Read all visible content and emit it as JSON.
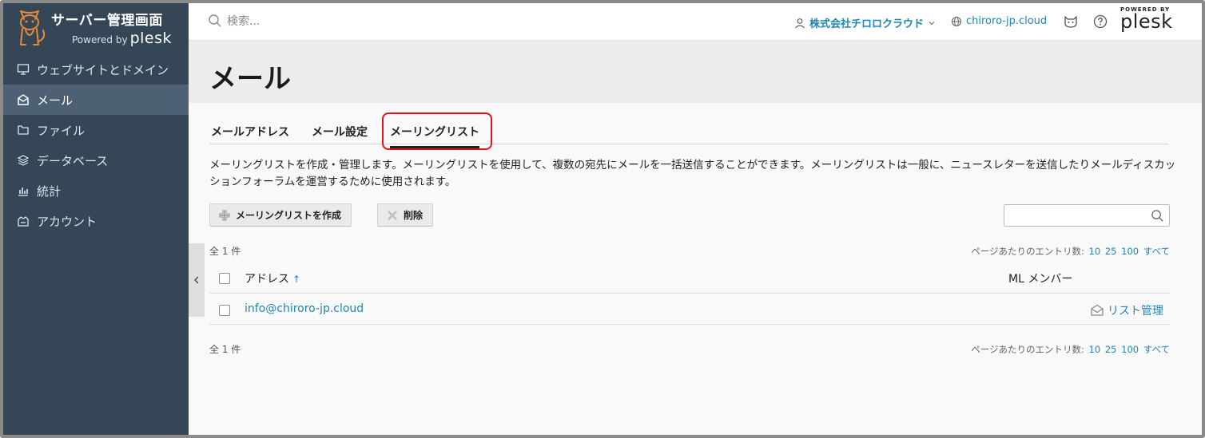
{
  "sidebar": {
    "brand_title": "サーバー管理画面",
    "brand_powered": "Powered by",
    "brand_plesk": "plesk",
    "items": [
      {
        "label": "ウェブサイトとドメイン",
        "icon": "monitor-icon"
      },
      {
        "label": "メール",
        "icon": "mail-icon",
        "active": true
      },
      {
        "label": "ファイル",
        "icon": "folder-icon"
      },
      {
        "label": "データベース",
        "icon": "database-icon"
      },
      {
        "label": "統計",
        "icon": "chart-icon"
      },
      {
        "label": "アカウント",
        "icon": "account-icon"
      }
    ]
  },
  "topbar": {
    "search_placeholder": "検索...",
    "account_name": "株式会社チロロクラウド",
    "domain_name": "chiroro-jp.cloud",
    "plesk_powered_by": "POWERED BY",
    "plesk_logo_text": "plesk"
  },
  "page": {
    "title": "メール",
    "tabs": [
      {
        "label": "メールアドレス"
      },
      {
        "label": "メール設定"
      },
      {
        "label": "メーリングリスト",
        "active": true
      }
    ],
    "description": "メーリングリストを作成・管理します。メーリングリストを使用して、複数の宛先にメールを一括送信することができます。メーリングリストは一般に、ニュースレターを送信したりメールディスカッションフォーラムを運営するために使用されます。",
    "create_button": "メーリングリストを作成",
    "delete_button": "削除",
    "count_top": "全 1 件",
    "count_bottom": "全 1 件",
    "per_page_label": "ページあたりのエントリ数:",
    "per_page_options": [
      "10",
      "25",
      "100",
      "すべて"
    ]
  },
  "table": {
    "columns": [
      "アドレス",
      "ML メンバー"
    ],
    "rows": [
      {
        "address": "info@chiroro-jp.cloud",
        "action": "リスト管理"
      }
    ]
  },
  "colors": {
    "sidebar_bg": "#354656",
    "sidebar_active": "#4e6174",
    "link": "#1e87b4",
    "highlight": "#e3121a"
  }
}
